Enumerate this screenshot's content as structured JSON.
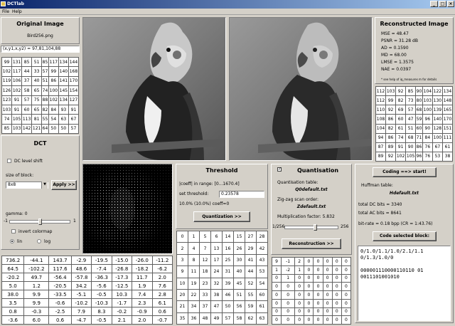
{
  "app": {
    "title": "DCTlab",
    "menu": [
      "File",
      "Help"
    ]
  },
  "original": {
    "heading": "Original Image",
    "filename": "Bird256.png",
    "coords": "(x,y1,x,y2) = 97,81,104,88",
    "pixels": [
      [
        99,
        131,
        85,
        51,
        85,
        117,
        134,
        144
      ],
      [
        102,
        117,
        44,
        33,
        57,
        99,
        140,
        168
      ],
      [
        119,
        106,
        37,
        40,
        51,
        86,
        141,
        170
      ],
      [
        126,
        102,
        58,
        65,
        74,
        100,
        145,
        154
      ],
      [
        123,
        91,
        57,
        75,
        88,
        102,
        134,
        127
      ],
      [
        103,
        91,
        60,
        65,
        82,
        84,
        93,
        91
      ],
      [
        74,
        105,
        113,
        81,
        55,
        54,
        63,
        67
      ],
      [
        85,
        103,
        142,
        121,
        64,
        50,
        50,
        57
      ]
    ]
  },
  "reconstructed": {
    "heading": "Reconstructed Image",
    "metrics": [
      "MSE = 48.47",
      "PSNR = 31.28 dB",
      "AD = 0.1590",
      "MD = 68.00",
      "LMSE = 1.3575",
      "NAE = 0.0397"
    ],
    "note": "* see help of iq_measures m for details",
    "pixels": [
      [
        112,
        103,
        92,
        85,
        90,
        104,
        122,
        134
      ],
      [
        112,
        99,
        82,
        73,
        80,
        103,
        130,
        148
      ],
      [
        110,
        92,
        69,
        57,
        68,
        100,
        139,
        165
      ],
      [
        108,
        86,
        60,
        47,
        59,
        96,
        140,
        170
      ],
      [
        104,
        82,
        61,
        51,
        60,
        90,
        128,
        151
      ],
      [
        94,
        86,
        74,
        68,
        71,
        84,
        100,
        111
      ],
      [
        87,
        89,
        91,
        90,
        86,
        76,
        67,
        61
      ],
      [
        89,
        92,
        102,
        105,
        96,
        76,
        53,
        38
      ]
    ]
  },
  "dct": {
    "heading": "DCT",
    "dc_shift_label": "DC level shift",
    "block_size_label": "size of block:",
    "block_size_value": "8x8",
    "apply_label": "Apply >>",
    "gamma_label": "gamma: 0",
    "gamma_min": "-1",
    "gamma_max": "1",
    "invert_label": "invert colormap",
    "lin_label": "lin",
    "log_label": "log",
    "coefficients": [
      [
        "736.2",
        "-44.1",
        "143.7",
        "-2.9",
        "-19.5",
        "-15.0",
        "-26.0",
        "-11.2"
      ],
      [
        "64.5",
        "-102.2",
        "117.6",
        "48.6",
        "-7.4",
        "-26.8",
        "-18.2",
        "-6.2"
      ],
      [
        "-20.2",
        "49.7",
        "-56.4",
        "-57.8",
        "-36.3",
        "-17.3",
        "11.7",
        "2.0"
      ],
      [
        "5.0",
        "1.2",
        "-20.5",
        "34.2",
        "-5.6",
        "-12.5",
        "1.9",
        "7.6"
      ],
      [
        "38.0",
        "9.9",
        "-33.5",
        "-5.1",
        "-0.5",
        "10.3",
        "7.4",
        "2.8"
      ],
      [
        "3.5",
        "9.9",
        "-0.6",
        "-10.2",
        "-10.3",
        "-1.7",
        "2.3",
        "6.1"
      ],
      [
        "0.8",
        "-0.3",
        "-2.5",
        "7.9",
        "8.3",
        "-0.2",
        "-0.9",
        "0.6"
      ],
      [
        "-3.6",
        "6.0",
        "0.6",
        "-4.7",
        "-0.5",
        "2.1",
        "2.0",
        "-0.7"
      ]
    ]
  },
  "threshold": {
    "heading": "Threshold",
    "range_text": "|coeff| in range: [0...1670.4]",
    "set_label": "set threshold:",
    "set_value": "0.23578",
    "result_text": "10.0% (10.0%) coeff=0",
    "button_label": "Quantization >>",
    "zigzag": [
      [
        "0",
        "1",
        "5",
        "6",
        "14",
        "15",
        "27",
        "28"
      ],
      [
        "2",
        "4",
        "7",
        "13",
        "16",
        "26",
        "29",
        "42"
      ],
      [
        "3",
        "8",
        "12",
        "17",
        "25",
        "30",
        "41",
        "43"
      ],
      [
        "9",
        "11",
        "18",
        "24",
        "31",
        "40",
        "44",
        "53"
      ],
      [
        "10",
        "19",
        "23",
        "32",
        "39",
        "45",
        "52",
        "54"
      ],
      [
        "20",
        "22",
        "33",
        "38",
        "46",
        "51",
        "55",
        "60"
      ],
      [
        "21",
        "34",
        "37",
        "47",
        "50",
        "56",
        "59",
        "61"
      ],
      [
        "35",
        "36",
        "48",
        "49",
        "57",
        "58",
        "62",
        "63"
      ]
    ]
  },
  "quantisation": {
    "heading": "Quantisation",
    "table_label": "Quantisation table:",
    "table_value": "Q0default.txt",
    "scan_label": "Zig-zag scan order:",
    "scan_value": "Zdefault.txt",
    "mult_label": "Multiplication factor: 5.832",
    "slider_min": "1/256",
    "slider_max": "256",
    "button_label": "Reconstruction >>",
    "values": [
      [
        "9",
        "-1",
        "2",
        "0",
        "0",
        "0",
        "0",
        "0"
      ],
      [
        "1",
        "-2",
        "1",
        "0",
        "0",
        "0",
        "0",
        "0"
      ],
      [
        "0",
        "1",
        "0",
        "0",
        "0",
        "0",
        "0",
        "0"
      ],
      [
        "0",
        "0",
        "0",
        "0",
        "0",
        "0",
        "0",
        "0"
      ],
      [
        "0",
        "0",
        "0",
        "0",
        "0",
        "0",
        "0",
        "0"
      ],
      [
        "0",
        "0",
        "0",
        "0",
        "0",
        "0",
        "0",
        "0"
      ],
      [
        "0",
        "0",
        "0",
        "0",
        "0",
        "0",
        "0",
        "0"
      ],
      [
        "0",
        "0",
        "0",
        "0",
        "0",
        "0",
        "0",
        "0"
      ]
    ]
  },
  "coding": {
    "start_label": "Coding ==> start!",
    "huffman_label": "Huffman table:",
    "huffman_value": "Hdefault.txt",
    "dc_bits": "total DC bits = 3340",
    "ac_bits": "total AC bits = 8641",
    "bitrate": "bit-rate = 0.18 bpp (CR = 1:43.76)",
    "code_block_label": "Code selected block:",
    "output_lines": [
      "0/1.0/1.1/1.0/2.1/1.1",
      "0/1.3/1.0/0",
      "",
      "000001110000110110 01",
      "0011101001010"
    ]
  }
}
